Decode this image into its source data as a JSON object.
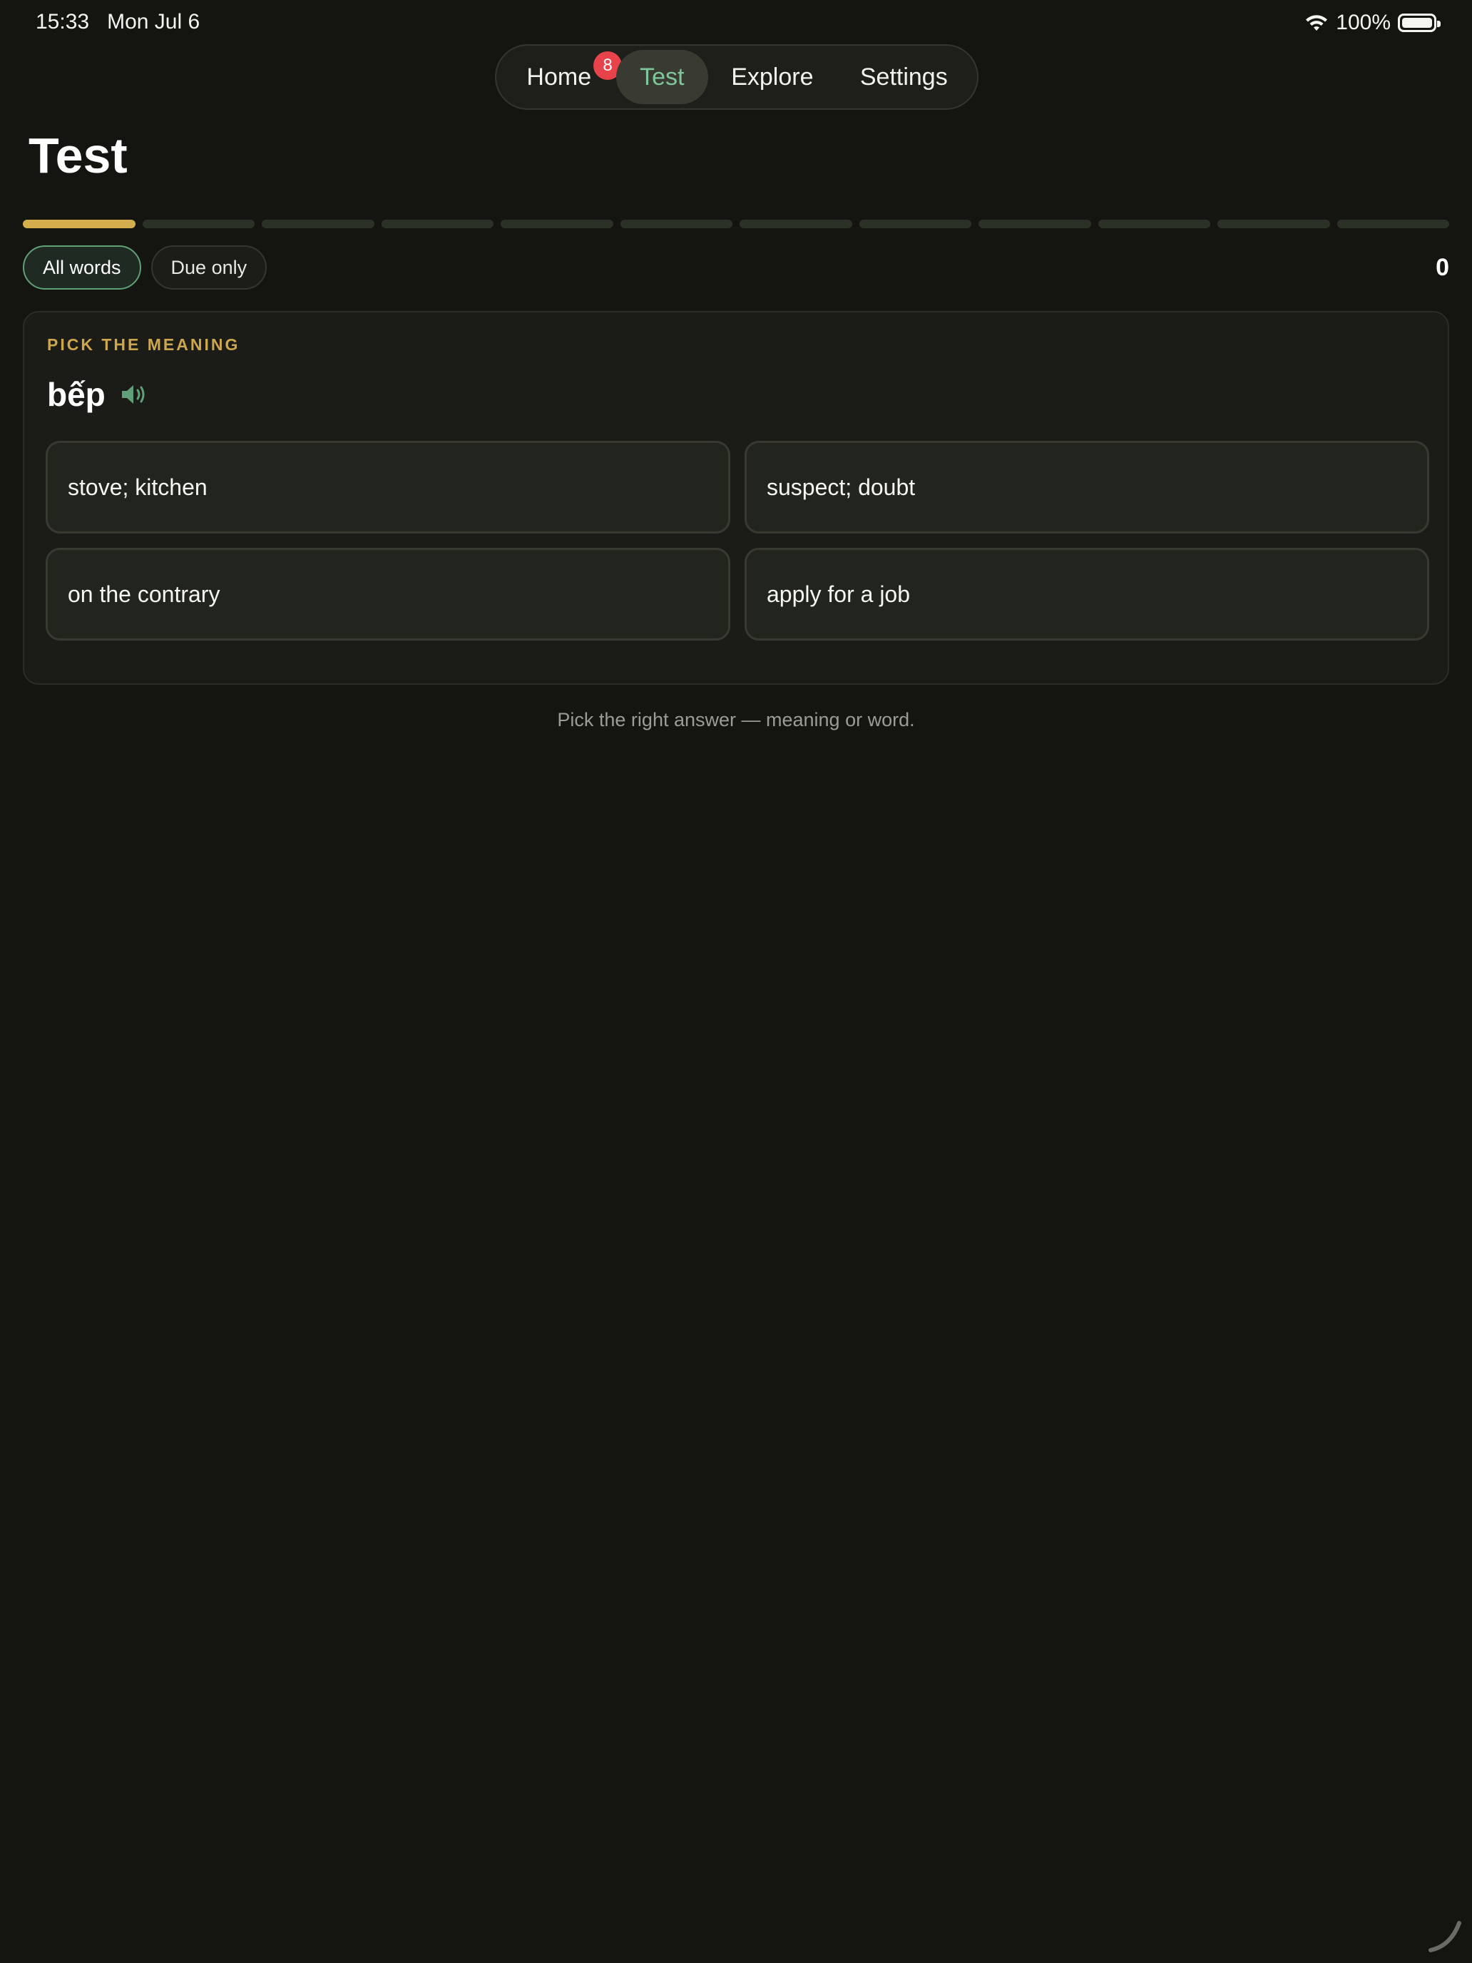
{
  "status_bar": {
    "time": "15:33",
    "date": "Mon Jul 6",
    "battery": "100%",
    "icons": [
      "wifi-icon",
      "battery-icon"
    ]
  },
  "nav": {
    "items": [
      {
        "label": "Home",
        "badge": "8"
      },
      {
        "label": "Test",
        "active": true
      },
      {
        "label": "Explore"
      },
      {
        "label": "Settings"
      }
    ]
  },
  "page": {
    "title": "Test"
  },
  "progress": {
    "total_segments": 12,
    "current": 1
  },
  "filters": {
    "all_words": "All words",
    "due_only": "Due only",
    "selected": "All words"
  },
  "score": "0",
  "quiz": {
    "prompt_label": "PICK THE MEANING",
    "word": "bếp",
    "speaker_icon": "speaker-icon",
    "options": [
      "stove; kitchen",
      "suspect; doubt",
      "on the contrary",
      "apply for a job"
    ]
  },
  "hint": "Pick the right answer — meaning or word.",
  "colors": {
    "background": "#141510",
    "accent_green": "#7fc79a",
    "accent_gold": "#d4ae4c",
    "badge_red": "#e8424a"
  }
}
